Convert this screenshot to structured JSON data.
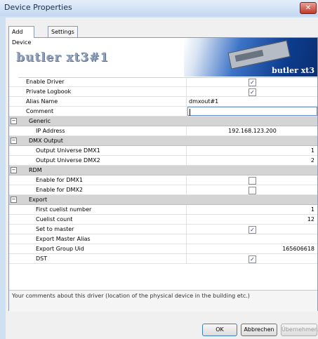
{
  "window": {
    "title": "Device Properties"
  },
  "tabs": [
    {
      "label": "Add Device"
    },
    {
      "label": "Settings"
    }
  ],
  "header": {
    "device_name": "butler xt3#1",
    "banner_text": "butler xt3"
  },
  "rows": [
    {
      "name": "Enable Driver",
      "type": "check",
      "checked": true
    },
    {
      "name": "Private Logbook",
      "type": "check",
      "checked": true
    },
    {
      "name": "Alias Name",
      "type": "text",
      "value": "dmxout#1"
    },
    {
      "name": "Comment",
      "type": "input",
      "value": ""
    },
    {
      "name": "Generic",
      "type": "cat"
    },
    {
      "name": "IP Address",
      "type": "center",
      "value": "192.168.123.200"
    },
    {
      "name": "DMX Output",
      "type": "cat"
    },
    {
      "name": "Output Universe DMX1",
      "type": "right",
      "value": "1"
    },
    {
      "name": "Output Universe DMX2",
      "type": "right",
      "value": "2"
    },
    {
      "name": "RDM",
      "type": "cat"
    },
    {
      "name": "Enable for DMX1",
      "type": "check",
      "checked": false
    },
    {
      "name": "Enable for DMX2",
      "type": "check",
      "checked": false
    },
    {
      "name": "Export",
      "type": "cat"
    },
    {
      "name": "First cuelist number",
      "type": "right",
      "value": "1"
    },
    {
      "name": "Cuelist count",
      "type": "right",
      "value": "12"
    },
    {
      "name": "Set to master",
      "type": "check",
      "checked": true
    },
    {
      "name": "Export Master Alias",
      "type": "right",
      "value": ""
    },
    {
      "name": "Export Group Uid",
      "type": "right",
      "value": "165606618"
    },
    {
      "name": "DST",
      "type": "check",
      "checked": true
    }
  ],
  "description": "Your comments about this driver (location of the physical device in the building etc.)",
  "buttons": {
    "ok": "OK",
    "cancel": "Abbrechen",
    "apply": "Übernehmen"
  }
}
